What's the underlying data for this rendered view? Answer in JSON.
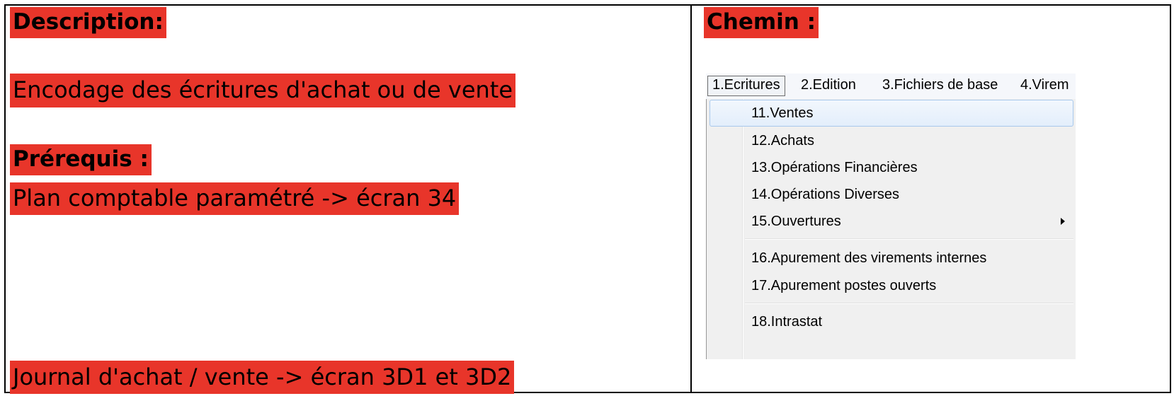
{
  "left": {
    "description_heading": "Description:",
    "description_text": "Encodage des écritures d'achat ou de vente",
    "prerequis_heading": "Prérequis :",
    "prerequis_text": "Plan comptable paramétré -> écran 34",
    "journal_text": "Journal d'achat / vente -> écran 3D1 et 3D2"
  },
  "right": {
    "chemin_heading": "Chemin :"
  },
  "menubar": {
    "items": [
      "1.Ecritures",
      "2.Edition",
      "3.Fichiers de base",
      "4.Virem"
    ]
  },
  "dropdown": {
    "items": [
      {
        "label": "11.Ventes"
      },
      {
        "label": "12.Achats"
      },
      {
        "label": "13.Opérations Financières"
      },
      {
        "label": "14.Opérations Diverses"
      },
      {
        "label": "15.Ouvertures",
        "submenu": true
      },
      {
        "label": "16.Apurement des virements internes"
      },
      {
        "label": "17.Apurement postes ouverts"
      },
      {
        "label": "18.Intrastat"
      }
    ],
    "hovered_index": 0
  },
  "colors": {
    "highlight": "#e8352a",
    "hover_border": "#a8c8ec"
  },
  "icons": [
    "submenu-arrow-icon"
  ]
}
